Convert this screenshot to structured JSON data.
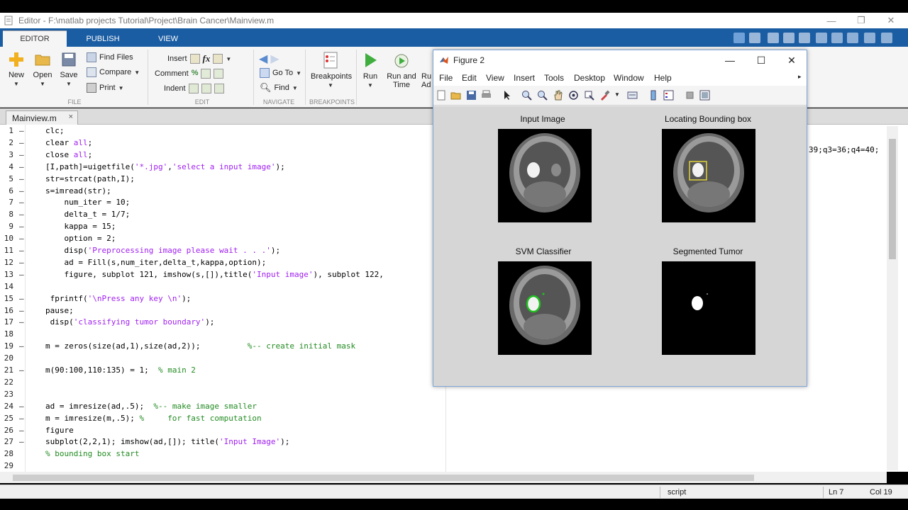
{
  "window": {
    "title": "Editor - F:\\matlab projects Tutorial\\Project\\Brain Cancer\\Mainview.m"
  },
  "ribbon_tabs": [
    {
      "label": "EDITOR",
      "active": true
    },
    {
      "label": "PUBLISH",
      "active": false
    },
    {
      "label": "VIEW",
      "active": false
    }
  ],
  "ribbon": {
    "new_label": "New",
    "open_label": "Open",
    "save_label": "Save",
    "find_files_label": "Find Files",
    "compare_label": "Compare",
    "print_label": "Print",
    "insert_label": "Insert",
    "comment_label": "Comment",
    "indent_label": "Indent",
    "goto_label": "Go To",
    "find_label": "Find",
    "breakpoints_label": "Breakpoints",
    "run_label": "Run",
    "run_and_time_label_1": "Run and",
    "run_and_time_label_2": "Time",
    "run_adv_label_1": "Ru",
    "run_adv_label_2": "Ad",
    "groups": {
      "file": "FILE",
      "edit": "EDIT",
      "navigate": "NAVIGATE",
      "breakpoints": "BREAKPOINTS"
    },
    "fx_label": "fx"
  },
  "doc_tab": {
    "label": "Mainview.m",
    "close": "×"
  },
  "code_lines": [
    {
      "n": "1",
      "dash": "—",
      "parts": [
        {
          "t": "clc;",
          "c": ""
        }
      ]
    },
    {
      "n": "2",
      "dash": "—",
      "parts": [
        {
          "t": "clear ",
          "c": ""
        },
        {
          "t": "all",
          "c": "str"
        },
        {
          "t": ";",
          "c": ""
        }
      ]
    },
    {
      "n": "3",
      "dash": "—",
      "parts": [
        {
          "t": "close ",
          "c": ""
        },
        {
          "t": "all",
          "c": "str"
        },
        {
          "t": ";",
          "c": ""
        }
      ]
    },
    {
      "n": "4",
      "dash": "—",
      "parts": [
        {
          "t": "[I,path]=uigetfile(",
          "c": ""
        },
        {
          "t": "'*.jpg'",
          "c": "str"
        },
        {
          "t": ",",
          "c": ""
        },
        {
          "t": "'select a input image'",
          "c": "str"
        },
        {
          "t": ");",
          "c": ""
        }
      ]
    },
    {
      "n": "5",
      "dash": "—",
      "parts": [
        {
          "t": "str=strcat(path,I);",
          "c": ""
        }
      ]
    },
    {
      "n": "6",
      "dash": "—",
      "parts": [
        {
          "t": "s=imread(str);",
          "c": ""
        }
      ]
    },
    {
      "n": "7",
      "dash": "—",
      "parts": [
        {
          "t": "    num_iter = 10;",
          "c": ""
        }
      ]
    },
    {
      "n": "8",
      "dash": "—",
      "parts": [
        {
          "t": "    delta_t = 1/7;",
          "c": ""
        }
      ]
    },
    {
      "n": "9",
      "dash": "—",
      "parts": [
        {
          "t": "    kappa = 15;",
          "c": ""
        }
      ]
    },
    {
      "n": "10",
      "dash": "—",
      "parts": [
        {
          "t": "    option = 2;",
          "c": ""
        }
      ]
    },
    {
      "n": "11",
      "dash": "—",
      "parts": [
        {
          "t": "    disp(",
          "c": ""
        },
        {
          "t": "'Preprocessing image please wait . . .'",
          "c": "str"
        },
        {
          "t": ");",
          "c": ""
        }
      ]
    },
    {
      "n": "12",
      "dash": "—",
      "parts": [
        {
          "t": "    ad = Fill(s,num_iter,delta_t,kappa,option);",
          "c": ""
        }
      ]
    },
    {
      "n": "13",
      "dash": "—",
      "parts": [
        {
          "t": "    figure, subplot 121, imshow(s,[]),title(",
          "c": ""
        },
        {
          "t": "'Input image'",
          "c": "str"
        },
        {
          "t": "), subplot 122, ",
          "c": ""
        }
      ]
    },
    {
      "n": "14",
      "dash": "",
      "parts": [
        {
          "t": "",
          "c": ""
        }
      ]
    },
    {
      "n": "15",
      "dash": "—",
      "parts": [
        {
          "t": " fprintf(",
          "c": ""
        },
        {
          "t": "'\\nPress any key \\n'",
          "c": "str"
        },
        {
          "t": ");",
          "c": ""
        }
      ]
    },
    {
      "n": "16",
      "dash": "—",
      "parts": [
        {
          "t": "pause;",
          "c": ""
        }
      ]
    },
    {
      "n": "17",
      "dash": "—",
      "parts": [
        {
          "t": " disp(",
          "c": ""
        },
        {
          "t": "'classifying tumor boundary'",
          "c": "str"
        },
        {
          "t": ");",
          "c": ""
        }
      ]
    },
    {
      "n": "18",
      "dash": "",
      "parts": [
        {
          "t": "",
          "c": ""
        }
      ]
    },
    {
      "n": "19",
      "dash": "—",
      "parts": [
        {
          "t": "m = zeros(size(ad,1),size(ad,2));          ",
          "c": ""
        },
        {
          "t": "%-- create initial mask",
          "c": "cmt"
        }
      ]
    },
    {
      "n": "20",
      "dash": "",
      "parts": [
        {
          "t": "",
          "c": ""
        }
      ]
    },
    {
      "n": "21",
      "dash": "—",
      "parts": [
        {
          "t": "m(90:100,110:135) = 1;  ",
          "c": ""
        },
        {
          "t": "% main 2",
          "c": "cmt"
        }
      ]
    },
    {
      "n": "22",
      "dash": "",
      "parts": [
        {
          "t": "",
          "c": ""
        }
      ]
    },
    {
      "n": "23",
      "dash": "",
      "parts": [
        {
          "t": "",
          "c": ""
        }
      ]
    },
    {
      "n": "24",
      "dash": "—",
      "parts": [
        {
          "t": "ad = imresize(ad,.5);  ",
          "c": ""
        },
        {
          "t": "%-- make image smaller",
          "c": "cmt"
        }
      ]
    },
    {
      "n": "25",
      "dash": "—",
      "parts": [
        {
          "t": "m = imresize(m,.5); ",
          "c": ""
        },
        {
          "t": "%     for fast computation",
          "c": "cmt"
        }
      ]
    },
    {
      "n": "26",
      "dash": "—",
      "parts": [
        {
          "t": "figure",
          "c": ""
        }
      ]
    },
    {
      "n": "27",
      "dash": "—",
      "parts": [
        {
          "t": "subplot(2,2,1); imshow(ad,[]); title(",
          "c": ""
        },
        {
          "t": "'Input Image'",
          "c": "str"
        },
        {
          "t": ");",
          "c": ""
        }
      ]
    },
    {
      "n": "28",
      "dash": "",
      "parts": [
        {
          "t": "% bounding box start",
          "c": "cmt"
        }
      ]
    },
    {
      "n": "29",
      "dash": "",
      "parts": [
        {
          "t": "",
          "c": ""
        }
      ]
    }
  ],
  "right_code_tail": "39;q3=36;q4=40;",
  "status": {
    "mode": "script",
    "line": "Ln  7",
    "col": "Col  19"
  },
  "figure": {
    "title": "Figure 2",
    "menu": [
      "File",
      "Edit",
      "View",
      "Insert",
      "Tools",
      "Desktop",
      "Window",
      "Help"
    ],
    "panels": [
      {
        "title": "Input Image"
      },
      {
        "title": "Locating Bounding box"
      },
      {
        "title": "SVM Classifier"
      },
      {
        "title": "Segmented Tumor"
      }
    ]
  }
}
